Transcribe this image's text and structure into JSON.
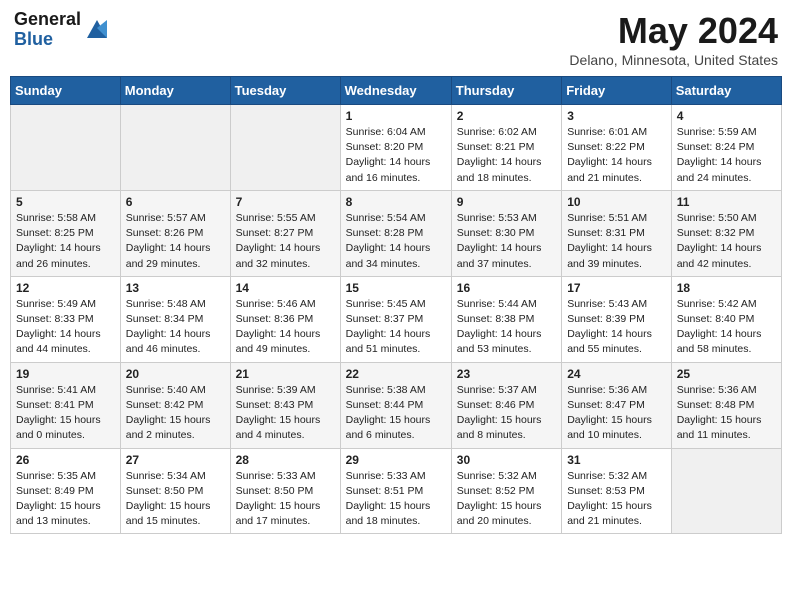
{
  "header": {
    "logo_general": "General",
    "logo_blue": "Blue",
    "month_year": "May 2024",
    "location": "Delano, Minnesota, United States"
  },
  "days_of_week": [
    "Sunday",
    "Monday",
    "Tuesday",
    "Wednesday",
    "Thursday",
    "Friday",
    "Saturday"
  ],
  "weeks": [
    [
      {
        "day": "",
        "info": ""
      },
      {
        "day": "",
        "info": ""
      },
      {
        "day": "",
        "info": ""
      },
      {
        "day": "1",
        "info": "Sunrise: 6:04 AM\nSunset: 8:20 PM\nDaylight: 14 hours\nand 16 minutes."
      },
      {
        "day": "2",
        "info": "Sunrise: 6:02 AM\nSunset: 8:21 PM\nDaylight: 14 hours\nand 18 minutes."
      },
      {
        "day": "3",
        "info": "Sunrise: 6:01 AM\nSunset: 8:22 PM\nDaylight: 14 hours\nand 21 minutes."
      },
      {
        "day": "4",
        "info": "Sunrise: 5:59 AM\nSunset: 8:24 PM\nDaylight: 14 hours\nand 24 minutes."
      }
    ],
    [
      {
        "day": "5",
        "info": "Sunrise: 5:58 AM\nSunset: 8:25 PM\nDaylight: 14 hours\nand 26 minutes."
      },
      {
        "day": "6",
        "info": "Sunrise: 5:57 AM\nSunset: 8:26 PM\nDaylight: 14 hours\nand 29 minutes."
      },
      {
        "day": "7",
        "info": "Sunrise: 5:55 AM\nSunset: 8:27 PM\nDaylight: 14 hours\nand 32 minutes."
      },
      {
        "day": "8",
        "info": "Sunrise: 5:54 AM\nSunset: 8:28 PM\nDaylight: 14 hours\nand 34 minutes."
      },
      {
        "day": "9",
        "info": "Sunrise: 5:53 AM\nSunset: 8:30 PM\nDaylight: 14 hours\nand 37 minutes."
      },
      {
        "day": "10",
        "info": "Sunrise: 5:51 AM\nSunset: 8:31 PM\nDaylight: 14 hours\nand 39 minutes."
      },
      {
        "day": "11",
        "info": "Sunrise: 5:50 AM\nSunset: 8:32 PM\nDaylight: 14 hours\nand 42 minutes."
      }
    ],
    [
      {
        "day": "12",
        "info": "Sunrise: 5:49 AM\nSunset: 8:33 PM\nDaylight: 14 hours\nand 44 minutes."
      },
      {
        "day": "13",
        "info": "Sunrise: 5:48 AM\nSunset: 8:34 PM\nDaylight: 14 hours\nand 46 minutes."
      },
      {
        "day": "14",
        "info": "Sunrise: 5:46 AM\nSunset: 8:36 PM\nDaylight: 14 hours\nand 49 minutes."
      },
      {
        "day": "15",
        "info": "Sunrise: 5:45 AM\nSunset: 8:37 PM\nDaylight: 14 hours\nand 51 minutes."
      },
      {
        "day": "16",
        "info": "Sunrise: 5:44 AM\nSunset: 8:38 PM\nDaylight: 14 hours\nand 53 minutes."
      },
      {
        "day": "17",
        "info": "Sunrise: 5:43 AM\nSunset: 8:39 PM\nDaylight: 14 hours\nand 55 minutes."
      },
      {
        "day": "18",
        "info": "Sunrise: 5:42 AM\nSunset: 8:40 PM\nDaylight: 14 hours\nand 58 minutes."
      }
    ],
    [
      {
        "day": "19",
        "info": "Sunrise: 5:41 AM\nSunset: 8:41 PM\nDaylight: 15 hours\nand 0 minutes."
      },
      {
        "day": "20",
        "info": "Sunrise: 5:40 AM\nSunset: 8:42 PM\nDaylight: 15 hours\nand 2 minutes."
      },
      {
        "day": "21",
        "info": "Sunrise: 5:39 AM\nSunset: 8:43 PM\nDaylight: 15 hours\nand 4 minutes."
      },
      {
        "day": "22",
        "info": "Sunrise: 5:38 AM\nSunset: 8:44 PM\nDaylight: 15 hours\nand 6 minutes."
      },
      {
        "day": "23",
        "info": "Sunrise: 5:37 AM\nSunset: 8:46 PM\nDaylight: 15 hours\nand 8 minutes."
      },
      {
        "day": "24",
        "info": "Sunrise: 5:36 AM\nSunset: 8:47 PM\nDaylight: 15 hours\nand 10 minutes."
      },
      {
        "day": "25",
        "info": "Sunrise: 5:36 AM\nSunset: 8:48 PM\nDaylight: 15 hours\nand 11 minutes."
      }
    ],
    [
      {
        "day": "26",
        "info": "Sunrise: 5:35 AM\nSunset: 8:49 PM\nDaylight: 15 hours\nand 13 minutes."
      },
      {
        "day": "27",
        "info": "Sunrise: 5:34 AM\nSunset: 8:50 PM\nDaylight: 15 hours\nand 15 minutes."
      },
      {
        "day": "28",
        "info": "Sunrise: 5:33 AM\nSunset: 8:50 PM\nDaylight: 15 hours\nand 17 minutes."
      },
      {
        "day": "29",
        "info": "Sunrise: 5:33 AM\nSunset: 8:51 PM\nDaylight: 15 hours\nand 18 minutes."
      },
      {
        "day": "30",
        "info": "Sunrise: 5:32 AM\nSunset: 8:52 PM\nDaylight: 15 hours\nand 20 minutes."
      },
      {
        "day": "31",
        "info": "Sunrise: 5:32 AM\nSunset: 8:53 PM\nDaylight: 15 hours\nand 21 minutes."
      },
      {
        "day": "",
        "info": ""
      }
    ]
  ]
}
